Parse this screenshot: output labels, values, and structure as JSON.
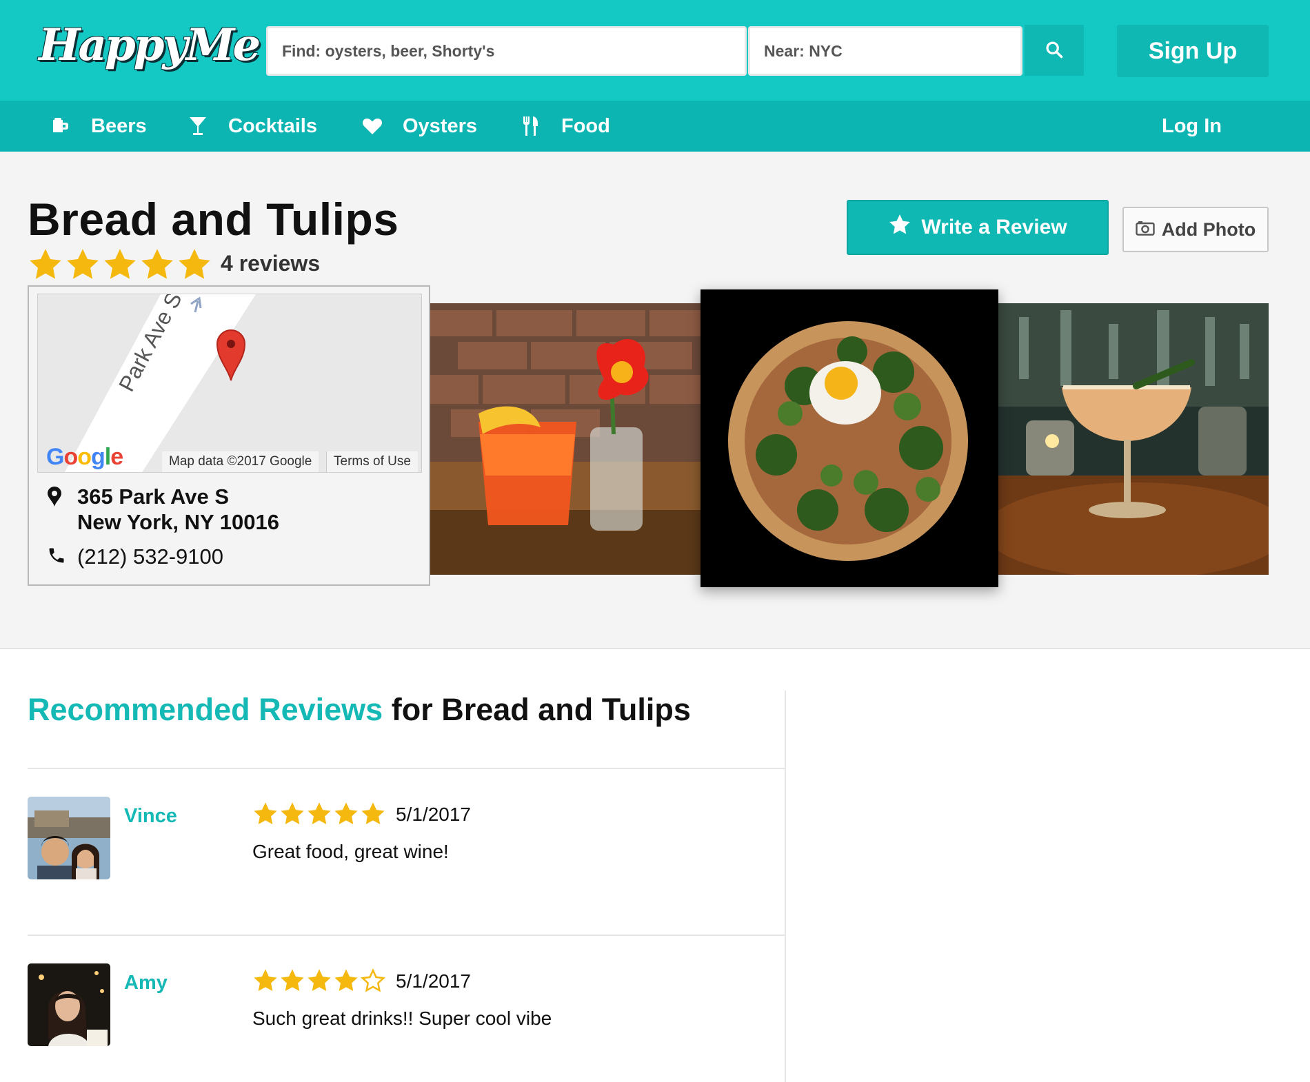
{
  "app": {
    "logo_text": "HappyMe"
  },
  "search": {
    "find_placeholder": "Find: oysters, beer, Shorty's",
    "near_placeholder": "Near: NYC"
  },
  "header": {
    "signup_label": "Sign Up",
    "login_label": "Log In"
  },
  "nav": {
    "items": [
      {
        "label": "Beers",
        "icon": "beer-mug-icon"
      },
      {
        "label": "Cocktails",
        "icon": "cocktail-glass-icon"
      },
      {
        "label": "Oysters",
        "icon": "heart-icon"
      },
      {
        "label": "Food",
        "icon": "fork-knife-icon"
      }
    ]
  },
  "business": {
    "name": "Bread and Tulips",
    "rating": 5,
    "review_count": "4 reviews",
    "write_review_label": "Write a Review",
    "add_photo_label": "Add Photo",
    "address_line1": "365 Park Ave S",
    "address_line2": "New York, NY 10016",
    "phone": "(212) 532-9100",
    "map": {
      "street_label": "Park Ave S",
      "attribution": "Map data ©2017 Google",
      "terms": "Terms of Use",
      "google_logo": "Google"
    },
    "photos": [
      "cocktail-and-tulip-photo",
      "pizza-with-egg-photo",
      "cocktail-glass-photo"
    ]
  },
  "reviews": {
    "heading_accent": "Recommended Reviews",
    "heading_rest": "for Bread and Tulips",
    "items": [
      {
        "name": "Vince",
        "rating": 5,
        "date": "5/1/2017",
        "text": "Great food, great wine!"
      },
      {
        "name": "Amy",
        "rating": 4,
        "date": "5/1/2017",
        "text": "Such great drinks!! Super cool vibe"
      }
    ]
  },
  "colors": {
    "brand": "#14c8c4",
    "nav": "#0cb5b1",
    "accent_text": "#14b8b4",
    "star": "#f5b80e"
  }
}
